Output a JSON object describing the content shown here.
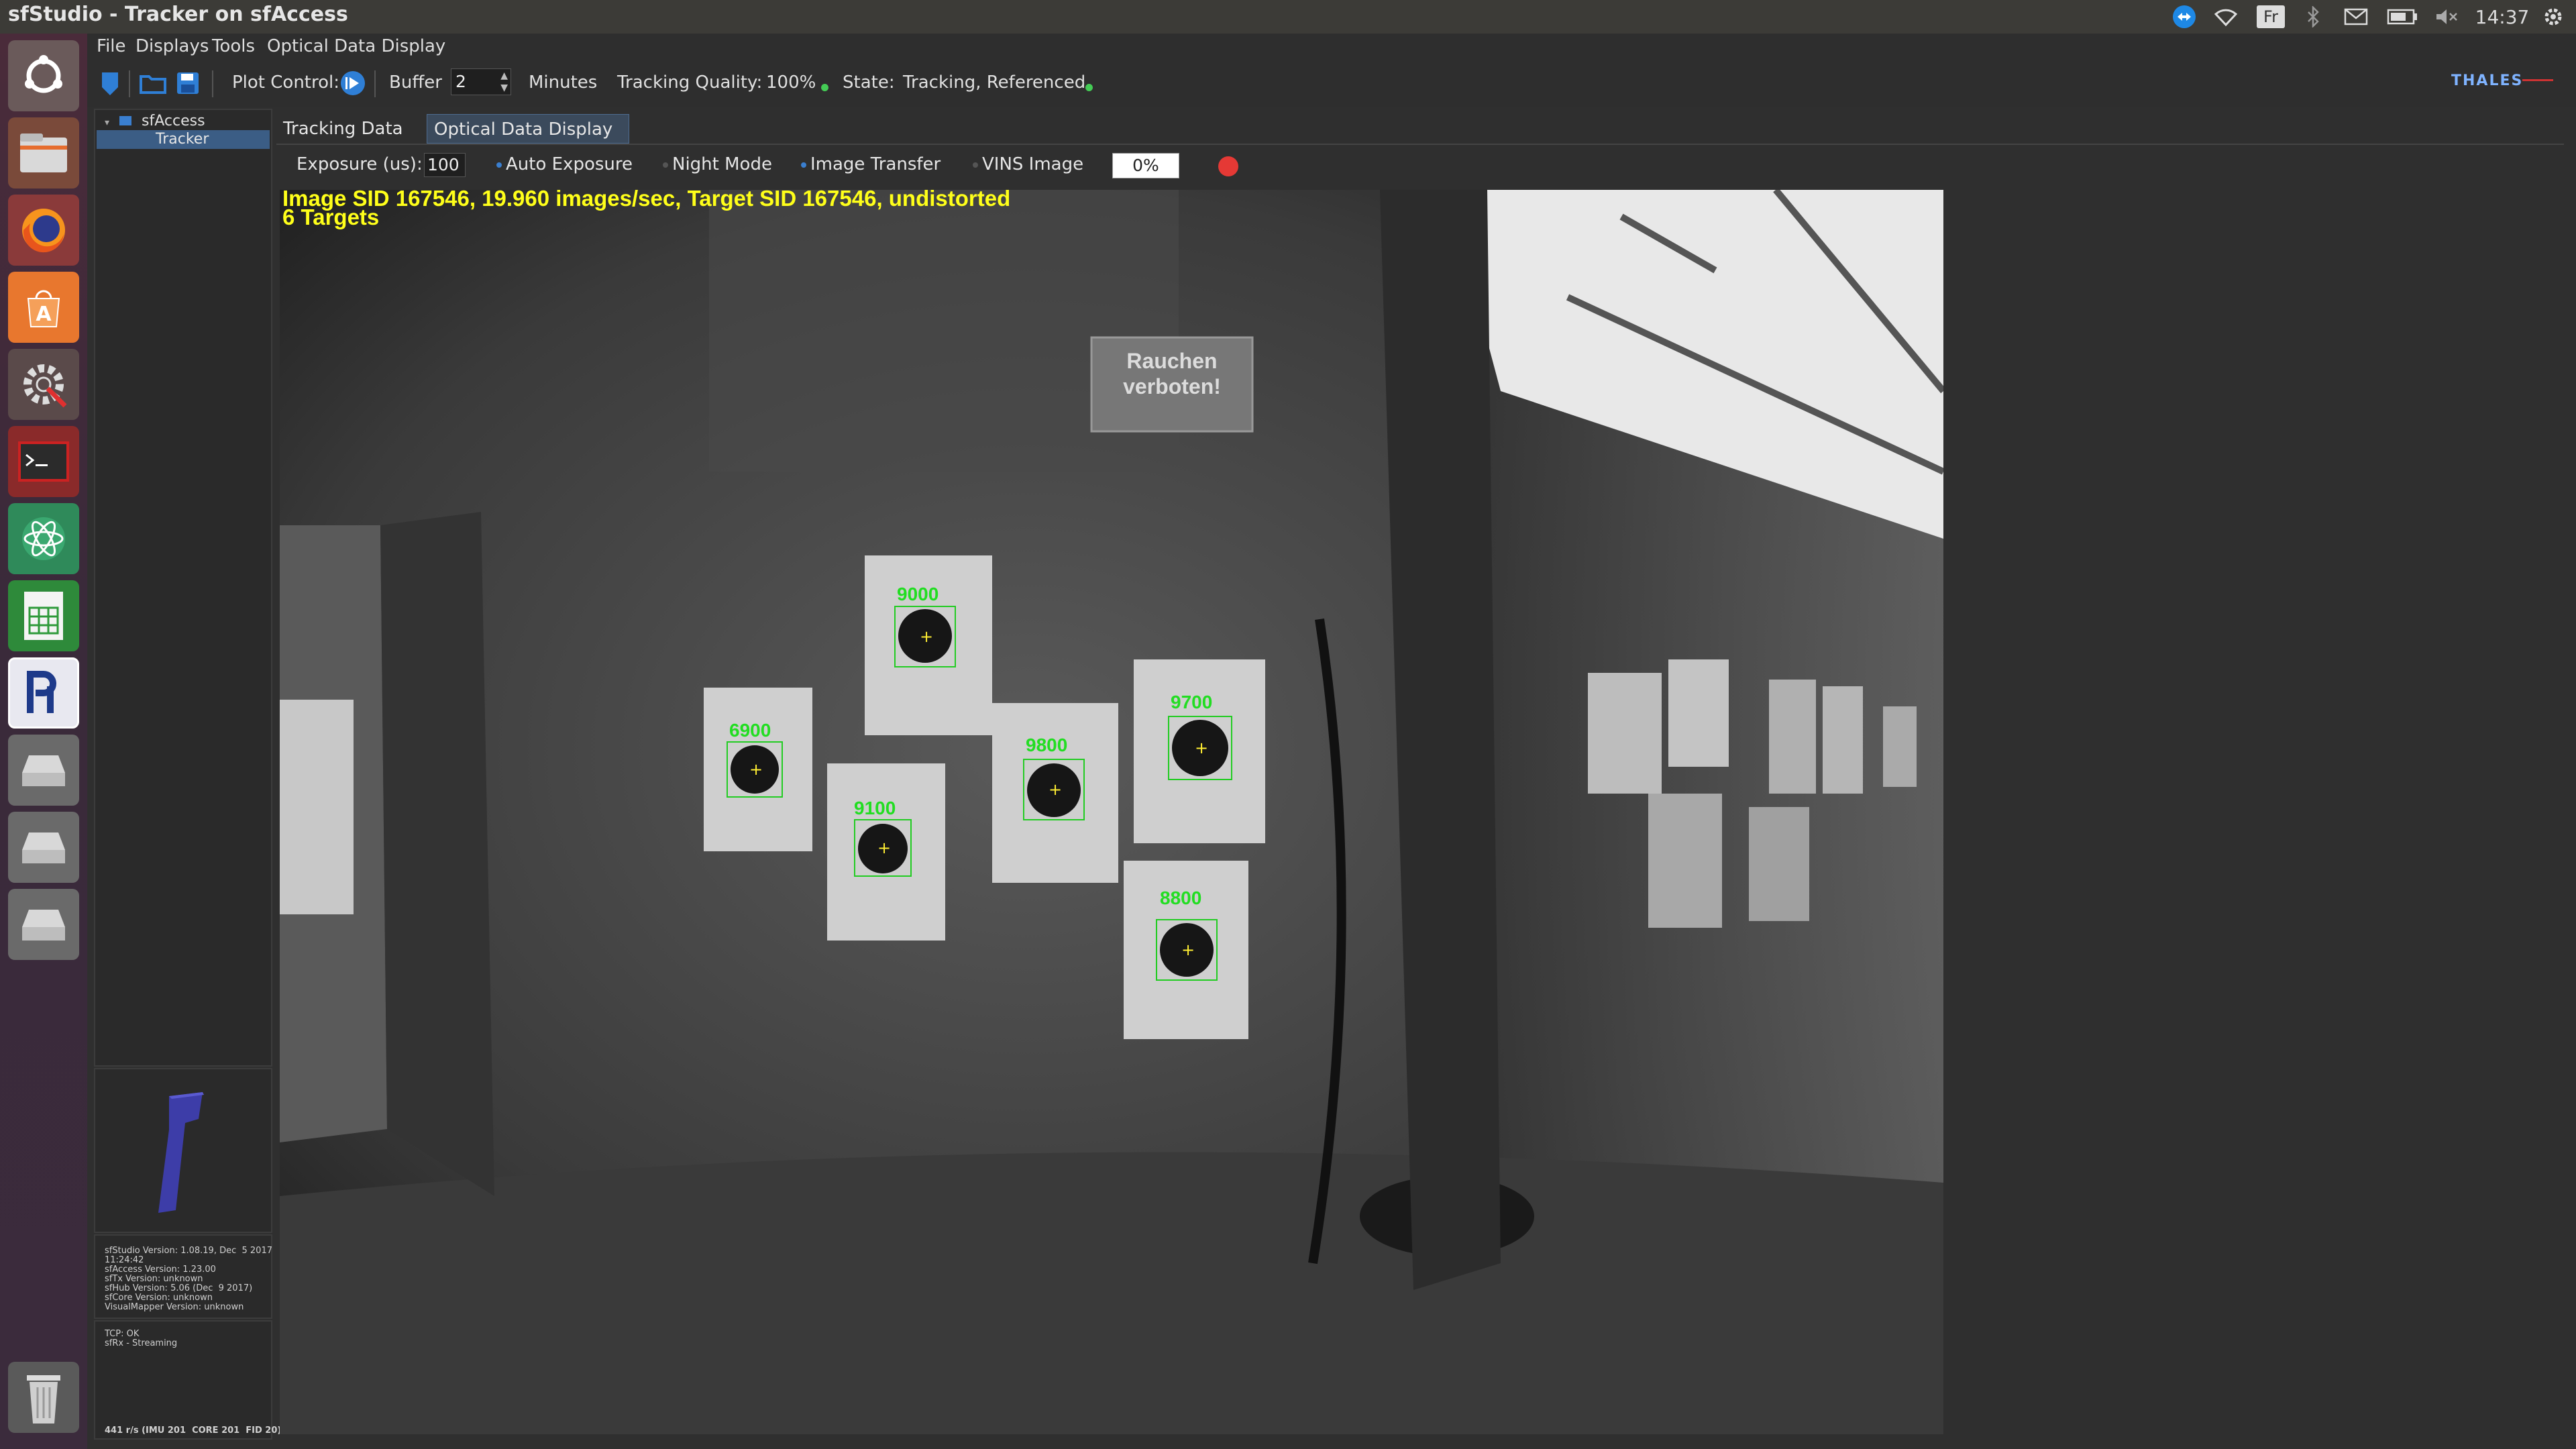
{
  "window": {
    "title": "sfStudio - Tracker on sfAccess"
  },
  "system_tray": {
    "keyboard": "Fr",
    "clock": "14:37"
  },
  "menu": [
    "File",
    "Displays",
    "Tools",
    "Optical Data Display"
  ],
  "toolbar": {
    "plot_control_label": "Plot Control:",
    "buffer_label": "Buffer",
    "buffer_value": "2",
    "buffer_unit": "Minutes",
    "tracking_quality_label": "Tracking Quality:",
    "tracking_quality_value": "100%",
    "state_label": "State:",
    "state_value": "Tracking, Referenced",
    "brand": "THALES"
  },
  "tree": {
    "root": "sfAccess",
    "child": "Tracker"
  },
  "info_panel": {
    "versions": "sfStudio Version: 1.08.19, Dec  5 2017\n11:24:42\nsfAccess Version: 1.23.00\nsfTx Version: unknown\nsfHub Version: 5.06 (Dec  9 2017)\nsfCore Version: unknown\nVisualMapper Version: unknown",
    "status": "TCP: OK\nsfRx - Streaming",
    "footer": "441 r/s (IMU 201  CORE 201  FID 20)"
  },
  "tabs": [
    {
      "label": "Tracking Data",
      "active": false
    },
    {
      "label": "Optical Data Display",
      "active": true
    }
  ],
  "controls": {
    "exposure_label": "Exposure (us):",
    "exposure_value": "100",
    "auto_exposure": "Auto Exposure",
    "night_mode": "Night Mode",
    "image_transfer": "Image Transfer",
    "vins_image": "VINS Image",
    "progress": "0%"
  },
  "camera": {
    "info_line": "Image SID 167546, 19.960 images/sec, Target SID 167546, undistorted",
    "targets_line": "6 Targets",
    "sign_text": "Rauchen\nverboten!",
    "targets": [
      {
        "id": "9000"
      },
      {
        "id": "6900"
      },
      {
        "id": "9100"
      },
      {
        "id": "9800"
      },
      {
        "id": "9700"
      },
      {
        "id": "8800"
      }
    ]
  },
  "colors": {
    "accent": "#3a7fd0",
    "status_ok": "#44cc55",
    "record": "#e53935",
    "overlay_text": "#ffff1a",
    "target_green": "#22cc22"
  },
  "icons": [
    "ubuntu-logo-icon",
    "files-icon",
    "firefox-icon",
    "software-center-icon",
    "settings-icon",
    "terminal-icon",
    "atom-icon",
    "spreadsheet-icon",
    "sfstudio-icon",
    "drive-icon",
    "trash-icon"
  ]
}
